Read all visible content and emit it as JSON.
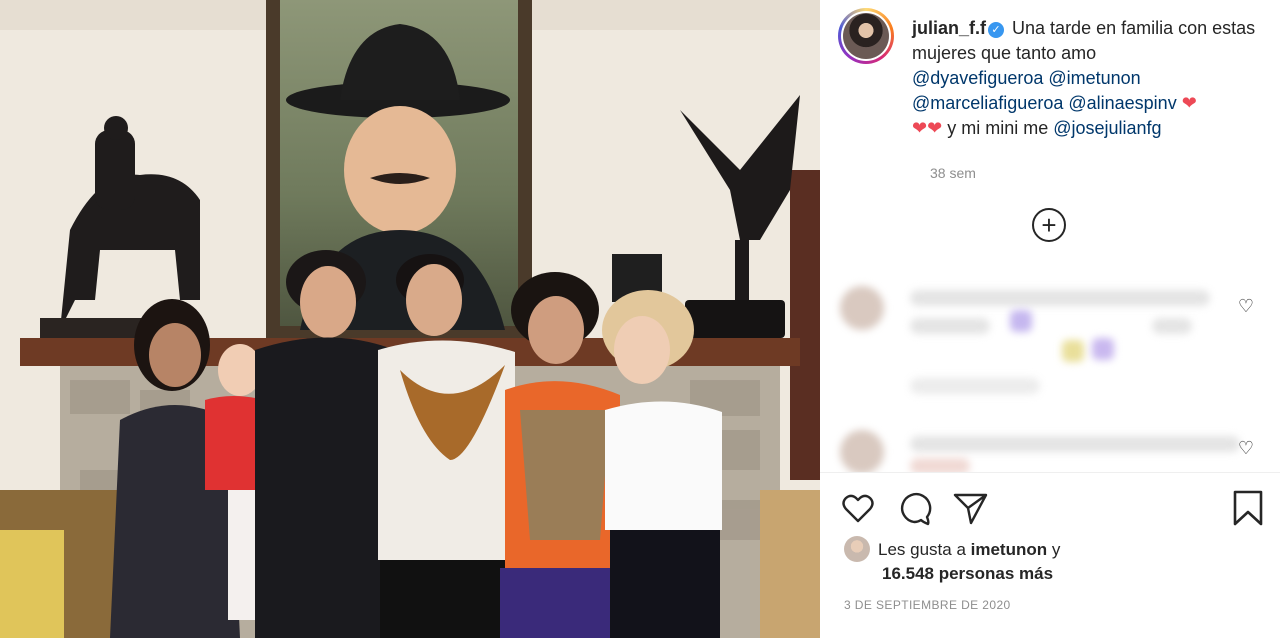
{
  "post": {
    "username": "julian_f.f",
    "verified": true,
    "caption_intro": "Una tarde en familia con estas mujeres que tanto amo",
    "mentions": [
      "@dyavefigueroa",
      "@imetunon",
      "@marceliafigueroa",
      "@alinaespinv"
    ],
    "hearts": "❤",
    "caption_tail": "y mi mini me",
    "tail_mention": "@josejulianfg",
    "time_ago": "38 sem"
  },
  "actions": {
    "load_more_symbol": "+"
  },
  "likes": {
    "prefix": "Les gusta a",
    "user": "imetunon",
    "connector": "y",
    "others": "16.548 personas más"
  },
  "date": "3 DE SEPTIEMBRE DE 2020",
  "icons": {
    "like": "heart-outline-icon",
    "comment": "comment-bubble-icon",
    "share": "paper-plane-icon",
    "save": "bookmark-icon"
  },
  "colors": {
    "mention": "#00376b",
    "verified": "#3897f0",
    "heart": "#ed4956",
    "muted": "#8e8e8e"
  }
}
